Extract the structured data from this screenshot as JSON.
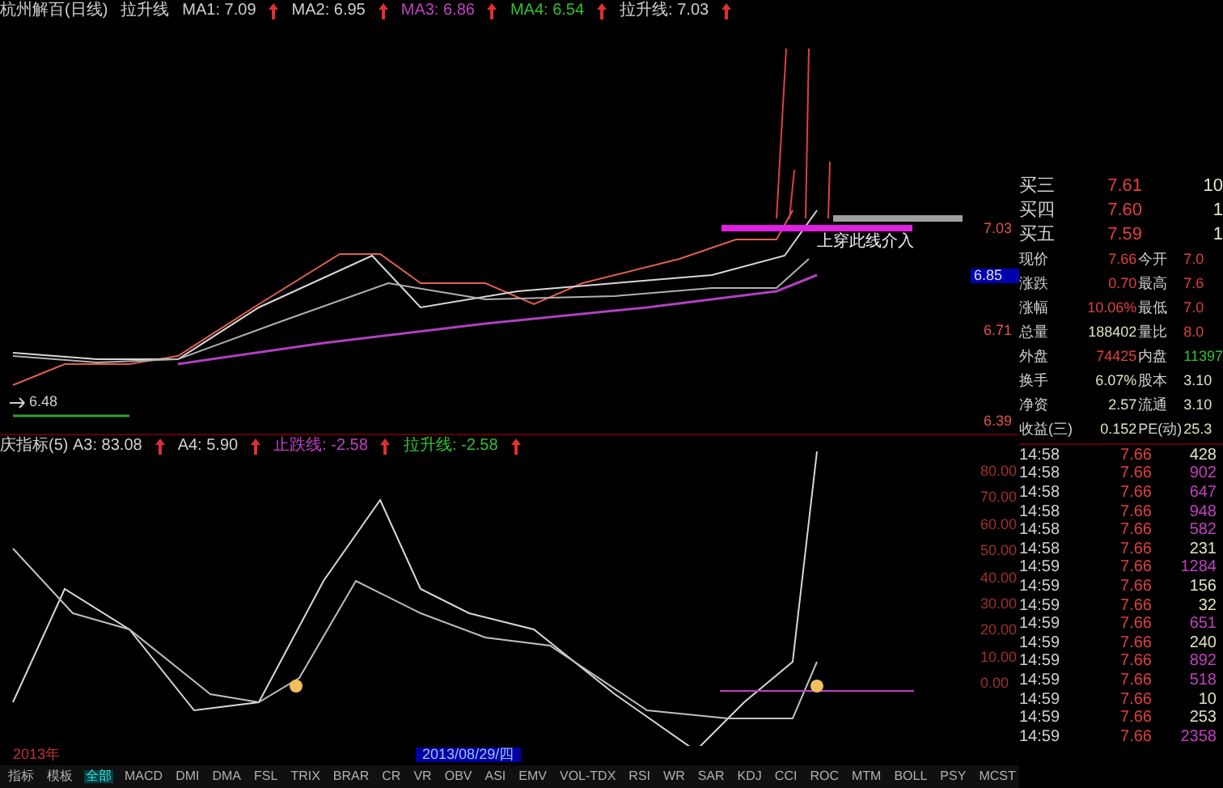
{
  "price_chart": {
    "legend": [
      {
        "text": "杭州解百(日线)",
        "color": "#d0d0d0",
        "arrow": false
      },
      {
        "text": "拉升线",
        "color": "#d0d0d0",
        "arrow": false
      },
      {
        "text": "MA1: 7.09",
        "color": "#d0d0d0",
        "arrow": true
      },
      {
        "text": "MA2: 6.95",
        "color": "#d0d0d0",
        "arrow": true
      },
      {
        "text": "MA3: 6.86",
        "color": "#c040c0",
        "arrow": true
      },
      {
        "text": "MA4: 6.54",
        "color": "#30c030",
        "arrow": true
      },
      {
        "text": "拉升线: 7.03",
        "color": "#d0d0d0",
        "arrow": true
      }
    ],
    "low_label": "6.48",
    "annotation": "上穿此线介入",
    "axis": [
      {
        "text": "7.03",
        "selected": false
      },
      {
        "text": "6.85",
        "selected": true
      },
      {
        "text": "6.71",
        "selected": false
      },
      {
        "text": "6.39",
        "selected": false
      }
    ]
  },
  "indicator_chart": {
    "legend": [
      {
        "text": "庆指标(5)  A3: 83.08",
        "color": "#d0d0d0",
        "arrow": true
      },
      {
        "text": "A4: 5.90",
        "color": "#d0d0d0",
        "arrow": true
      },
      {
        "text": "止跌线: -2.58",
        "color": "#c040c0",
        "arrow": true
      },
      {
        "text": "拉升线: -2.58",
        "color": "#30c030",
        "arrow": true
      }
    ],
    "axis": [
      "80.00",
      "70.00",
      "60.00",
      "50.00",
      "40.00",
      "30.00",
      "20.00",
      "10.00",
      "0.00"
    ]
  },
  "date_bar": {
    "year": "2013年",
    "date": "2013/08/29/四"
  },
  "tabs": [
    {
      "label": "指标",
      "selected": false
    },
    {
      "label": "模板",
      "selected": false
    },
    {
      "label": "全部",
      "selected": true
    },
    {
      "label": "MACD",
      "selected": false
    },
    {
      "label": "DMI",
      "selected": false
    },
    {
      "label": "DMA",
      "selected": false
    },
    {
      "label": "FSL",
      "selected": false
    },
    {
      "label": "TRIX",
      "selected": false
    },
    {
      "label": "BRAR",
      "selected": false
    },
    {
      "label": "CR",
      "selected": false
    },
    {
      "label": "VR",
      "selected": false
    },
    {
      "label": "OBV",
      "selected": false
    },
    {
      "label": "ASI",
      "selected": false
    },
    {
      "label": "EMV",
      "selected": false
    },
    {
      "label": "VOL-TDX",
      "selected": false
    },
    {
      "label": "RSI",
      "selected": false
    },
    {
      "label": "WR",
      "selected": false
    },
    {
      "label": "SAR",
      "selected": false
    },
    {
      "label": "KDJ",
      "selected": false
    },
    {
      "label": "CCI",
      "selected": false
    },
    {
      "label": "ROC",
      "selected": false
    },
    {
      "label": "MTM",
      "selected": false
    },
    {
      "label": "BOLL",
      "selected": false
    },
    {
      "label": "PSY",
      "selected": false
    },
    {
      "label": "MCST",
      "selected": false
    }
  ],
  "order_book": [
    {
      "label": "买三",
      "price": "7.61",
      "volume": "10"
    },
    {
      "label": "买四",
      "price": "7.60",
      "volume": "1"
    },
    {
      "label": "买五",
      "price": "7.59",
      "volume": "1"
    }
  ],
  "quote": [
    [
      {
        "label": "现价",
        "value": "7.66",
        "color": "#e04040"
      },
      {
        "label": "今开",
        "value": "7.0",
        "color": "#e04040"
      }
    ],
    [
      {
        "label": "涨跌",
        "value": "0.70",
        "color": "#e04040"
      },
      {
        "label": "最高",
        "value": "7.6",
        "color": "#e04040"
      }
    ],
    [
      {
        "label": "涨幅",
        "value": "10.06%",
        "color": "#e04040"
      },
      {
        "label": "最低",
        "value": "7.0",
        "color": "#e04040"
      }
    ],
    [
      {
        "label": "总量",
        "value": "188402",
        "color": "#e0e0c0"
      },
      {
        "label": "量比",
        "value": "8.0",
        "color": "#e04040"
      }
    ],
    [
      {
        "label": "外盘",
        "value": "74425",
        "color": "#e04040"
      },
      {
        "label": "内盘",
        "value": "11397",
        "color": "#30c030"
      }
    ],
    [
      {
        "label": "换手",
        "value": "6.07%",
        "color": "#e0e0c0"
      },
      {
        "label": "股本",
        "value": "3.10",
        "color": "#e0e0c0"
      }
    ],
    [
      {
        "label": "净资",
        "value": "2.57",
        "color": "#e0e0c0"
      },
      {
        "label": "流通",
        "value": "3.10",
        "color": "#e0e0c0"
      }
    ],
    [
      {
        "label": "收益(三)",
        "value": "0.152",
        "color": "#e0e0c0"
      },
      {
        "label": "PE(动)",
        "value": "25.3",
        "color": "#e0e0c0"
      }
    ]
  ],
  "trades": [
    {
      "time": "14:58",
      "price": "7.66",
      "volume": "428",
      "color": "#e0e0c0"
    },
    {
      "time": "14:58",
      "price": "7.66",
      "volume": "902",
      "color": "#c040c0"
    },
    {
      "time": "14:58",
      "price": "7.66",
      "volume": "647",
      "color": "#c040c0"
    },
    {
      "time": "14:58",
      "price": "7.66",
      "volume": "948",
      "color": "#c040c0"
    },
    {
      "time": "14:58",
      "price": "7.66",
      "volume": "582",
      "color": "#c040c0"
    },
    {
      "time": "14:58",
      "price": "7.66",
      "volume": "231",
      "color": "#e0e0c0"
    },
    {
      "time": "14:59",
      "price": "7.66",
      "volume": "1284",
      "color": "#c040c0"
    },
    {
      "time": "14:59",
      "price": "7.66",
      "volume": "156",
      "color": "#e0e0c0"
    },
    {
      "time": "14:59",
      "price": "7.66",
      "volume": "32",
      "color": "#e0e0c0"
    },
    {
      "time": "14:59",
      "price": "7.66",
      "volume": "651",
      "color": "#c040c0"
    },
    {
      "time": "14:59",
      "price": "7.66",
      "volume": "240",
      "color": "#e0e0c0"
    },
    {
      "time": "14:59",
      "price": "7.66",
      "volume": "892",
      "color": "#c040c0"
    },
    {
      "time": "14:59",
      "price": "7.66",
      "volume": "518",
      "color": "#c040c0"
    },
    {
      "time": "14:59",
      "price": "7.66",
      "volume": "10",
      "color": "#e0e0c0"
    },
    {
      "time": "14:59",
      "price": "7.66",
      "volume": "253",
      "color": "#e0e0c0"
    },
    {
      "time": "14:59",
      "price": "7.66",
      "volume": "2358",
      "color": "#c040c0"
    }
  ]
}
